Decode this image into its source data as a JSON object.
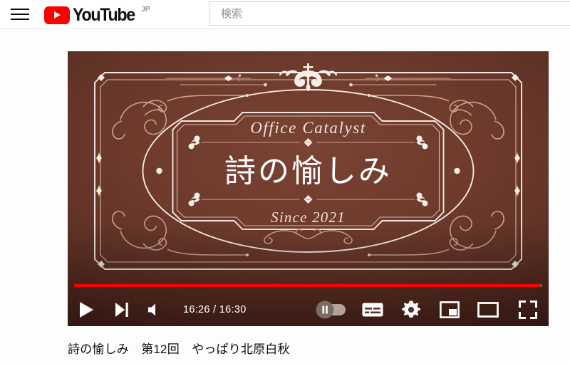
{
  "header": {
    "menu_icon": "hamburger-menu-icon",
    "logo_text": "YouTube",
    "logo_country": "JP",
    "search_placeholder": "検索",
    "search_value": ""
  },
  "player": {
    "thumbnail": {
      "brand_line": "Office  Catalyst",
      "main_title": "詩の愉しみ",
      "since_line": "Since 2021",
      "bg_color": "#6d3a2c",
      "ornament_color": "#c59a86",
      "frame_color": "#f2e6df"
    },
    "progress": {
      "percent": 99.6,
      "bar_color": "#ff0000"
    },
    "controls": {
      "play_label": "play-button",
      "next_label": "next-video-button",
      "volume_label": "volume-button",
      "time_text": "16:26 / 16:30",
      "current_time": "16:26",
      "duration": "16:30",
      "autoplay_label": "autoplay-toggle",
      "subtitles_label": "subtitles-button",
      "settings_label": "settings-button",
      "miniplayer_label": "miniplayer-button",
      "theater_label": "theater-mode-button",
      "fullscreen_label": "fullscreen-button"
    }
  },
  "video": {
    "title": "詩の愉しみ　第12回　やっぱり北原白秋"
  }
}
